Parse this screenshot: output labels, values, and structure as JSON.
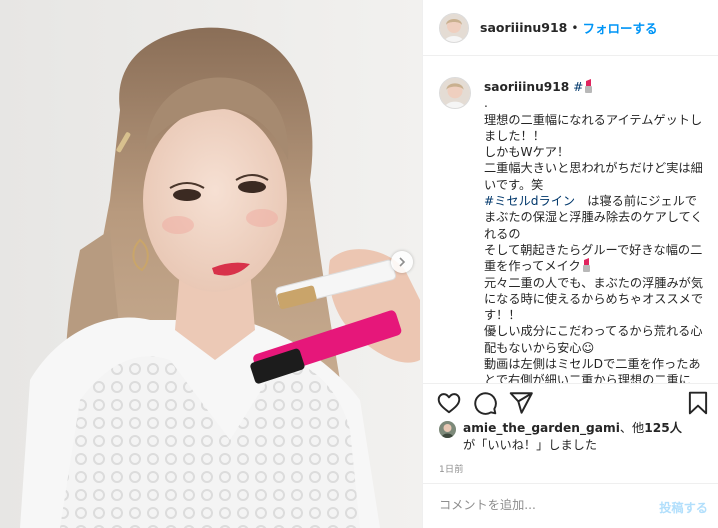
{
  "header": {
    "username": "saoriiinu918",
    "separator": "•",
    "follow_label": "フォローする"
  },
  "caption": {
    "username": "saoriiinu918",
    "hash": "#",
    "lines": [
      ".",
      "理想の二重幅になれるアイテムゲットしました！！",
      "しかもWケア！",
      "二重幅大きいと思われがちだけど実は細いです。笑"
    ],
    "hashtag": "#ミセルdライン",
    "after_hashtag": "　は寝る前にジェルでまぶたの保湿と浮腫み除去のケアしてくれるの",
    "lines2": [
      "そして朝起きたらグルーで好きな幅の二重を作ってメイク"
    ],
    "lines3": [
      "元々二重の人でも、まぶたの浮腫みが気になる時に使えるからめちゃオススメです！！",
      "優しい成分にこだわってるから荒れる心配もないから安心☺",
      "動画は左側はミセルDで二重を作ったあとで右側が細い二重から理想の二重に"
    ]
  },
  "likes": {
    "username": "amie_the_garden_gami",
    "and_others": "、他",
    "count": "125人",
    "suffix": "が「いいね！」しました"
  },
  "timestamp": "1日前",
  "comment": {
    "placeholder": "コメントを追加...",
    "post_label": "投稿する"
  },
  "colors": {
    "accent": "#0095f6",
    "hashtag": "#00376b",
    "post_disabled": "#b2dffc",
    "lipstick_emoji": "#e0245e"
  },
  "icons": [
    "heart-icon",
    "comment-icon",
    "share-icon",
    "bookmark-icon",
    "chevron-right-icon",
    "lipstick-emoji-icon"
  ]
}
